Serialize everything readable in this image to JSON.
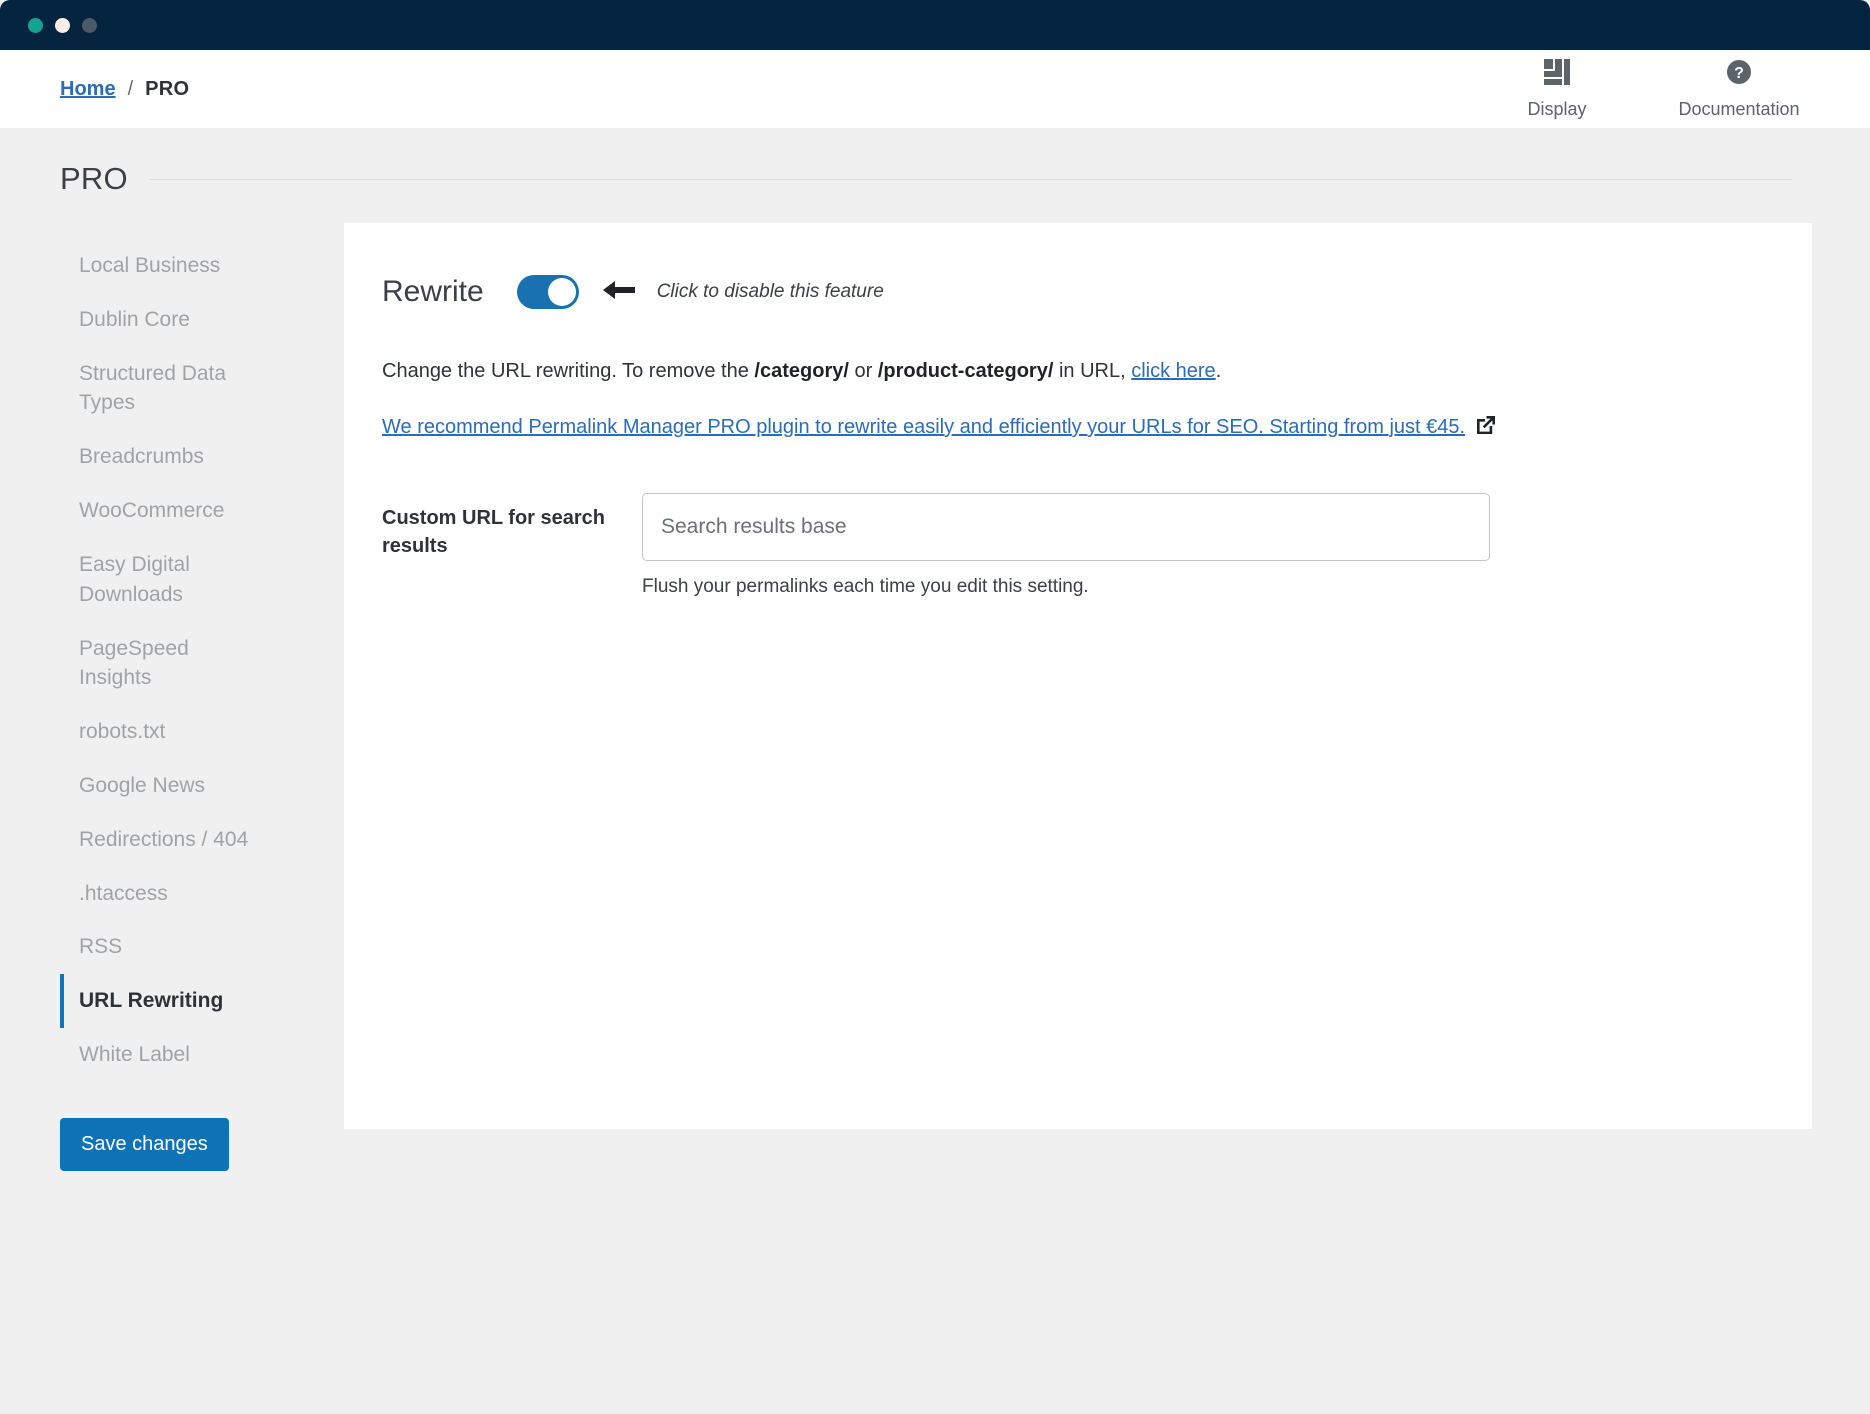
{
  "window": {
    "dots": [
      {
        "name": "traffic-light-green",
        "color": "#13a391"
      },
      {
        "name": "traffic-light-white",
        "color": "#fbeee9"
      },
      {
        "name": "traffic-light-gray",
        "color": "#4a5a66"
      }
    ],
    "titlebar_color": "#052440"
  },
  "breadcrumb": {
    "home_label": "Home",
    "separator": "/",
    "current_label": "PRO"
  },
  "top_actions": [
    {
      "icon": "display-layout-icon",
      "label": "Display"
    },
    {
      "icon": "question-circle-icon",
      "label": "Documentation"
    }
  ],
  "page": {
    "title": "PRO"
  },
  "sidebar": {
    "items": [
      {
        "label": "Local Business",
        "active": false
      },
      {
        "label": "Dublin Core",
        "active": false
      },
      {
        "label": "Structured Data Types",
        "active": false
      },
      {
        "label": "Breadcrumbs",
        "active": false
      },
      {
        "label": "WooCommerce",
        "active": false
      },
      {
        "label": "Easy Digital Downloads",
        "active": false
      },
      {
        "label": "PageSpeed Insights",
        "active": false
      },
      {
        "label": "robots.txt",
        "active": false
      },
      {
        "label": "Google News",
        "active": false
      },
      {
        "label": "Redirections / 404",
        "active": false
      },
      {
        "label": ".htaccess",
        "active": false
      },
      {
        "label": "RSS",
        "active": false
      },
      {
        "label": "URL Rewriting",
        "active": true
      },
      {
        "label": "White Label",
        "active": false
      }
    ],
    "save_label": "Save changes",
    "save_color": "#0d72b6",
    "active_accent": "#1074bb"
  },
  "main": {
    "rewrite_title": "Rewrite",
    "toggle_on": true,
    "toggle_color": "#1a71af",
    "toggle_hint": "Click to disable this feature",
    "description": {
      "part1": "Change the URL rewriting. To remove the ",
      "bold1": "/category/",
      "part2": " or ",
      "bold2": "/product-category/",
      "part3": " in URL, ",
      "link": "click here",
      "part4": "."
    },
    "promo_link": "We recommend Permalink Manager PRO plugin to rewrite easily and efficiently your URLs for SEO. Starting from just €45.",
    "promo_icon": "external-link-icon",
    "field": {
      "label": "Custom URL for search results",
      "value": "",
      "placeholder": "Search results base",
      "help": "Flush your permalinks each time you edit this setting."
    }
  }
}
